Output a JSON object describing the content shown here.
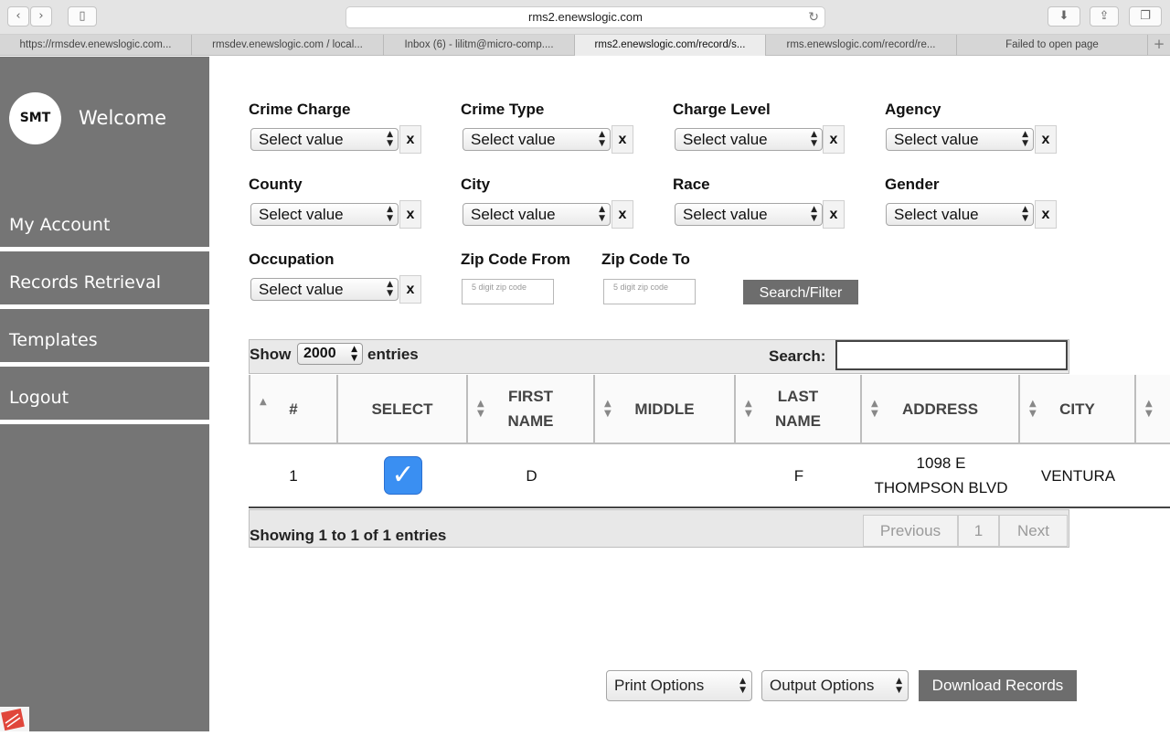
{
  "browser": {
    "url": "rms2.enewslogic.com",
    "tabs": [
      "https://rmsdev.enewslogic.com...",
      "rmsdev.enewslogic.com / local...",
      "Inbox (6) - lilitm@micro-comp....",
      "rms2.enewslogic.com/record/s...",
      "rms.enewslogic.com/record/re...",
      "Failed to open page"
    ],
    "active_tab": 3
  },
  "sidebar": {
    "logo": "SMT",
    "welcome": "Welcome",
    "items": [
      "My Account",
      "Records Retrieval",
      "Templates",
      "Logout"
    ]
  },
  "filters": {
    "crime_charge": {
      "label": "Crime Charge",
      "value": "Select value"
    },
    "crime_type": {
      "label": "Crime Type",
      "value": "Select value"
    },
    "charge_level": {
      "label": "Charge Level",
      "value": "Select value"
    },
    "agency": {
      "label": "Agency",
      "value": "Select value"
    },
    "county": {
      "label": "County",
      "value": "Select value"
    },
    "city": {
      "label": "City",
      "value": "Select value"
    },
    "race": {
      "label": "Race",
      "value": "Select value"
    },
    "gender": {
      "label": "Gender",
      "value": "Select value"
    },
    "occupation": {
      "label": "Occupation",
      "value": "Select value"
    },
    "zip_from": {
      "label": "Zip Code From",
      "placeholder": "5 digit zip code"
    },
    "zip_to": {
      "label": "Zip Code To",
      "placeholder": "5 digit zip code"
    },
    "clear": "x",
    "search_button": "Search/Filter"
  },
  "table": {
    "show_label": "Show",
    "entries_value": "2000",
    "entries_label": "entries",
    "search_label": "Search:",
    "search_value": "",
    "columns": [
      "#",
      "SELECT",
      "FIRST\nNAME",
      "MIDDLE",
      "LAST\nNAME",
      "ADDRESS",
      "CITY"
    ],
    "rows": [
      {
        "num": "1",
        "selected": true,
        "first": "D",
        "middle": "",
        "last": "F",
        "address": "1098 E\nTHOMPSON BLVD",
        "city": "VENTURA"
      }
    ],
    "info": "Showing 1 to 1 of 1 entries",
    "prev": "Previous",
    "page": "1",
    "next": "Next"
  },
  "actions": {
    "print_options": "Print Options",
    "output_options": "Output Options",
    "download": "Download Records"
  }
}
